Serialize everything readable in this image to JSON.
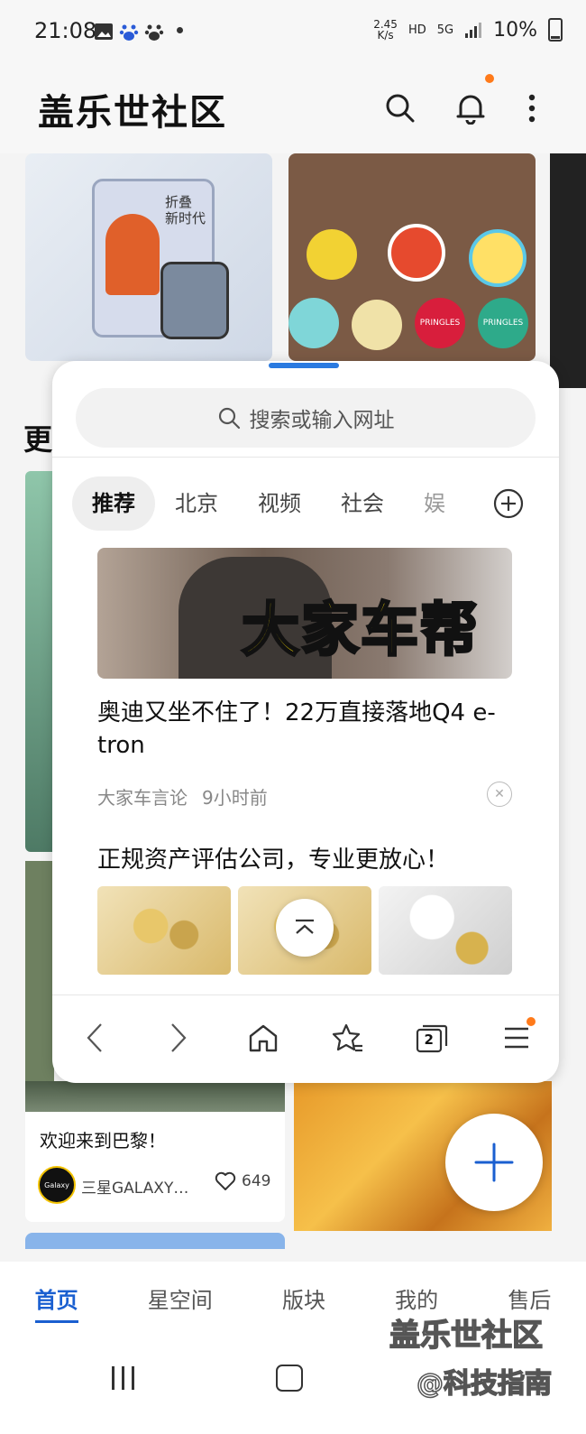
{
  "status_bar": {
    "time": "21:08",
    "speed_value": "2.45",
    "speed_unit": "K/s",
    "hd": "HD",
    "net": "5G",
    "battery": "10%"
  },
  "app": {
    "title": "盖乐世社区"
  },
  "feed": {
    "section_partial": "更",
    "post_caption": "欢迎来到巴黎！",
    "author": "三星GALAXY…",
    "avatar_text": "Galaxy",
    "likes": "649",
    "fold_ad_text": "折叠\n新时代",
    "pringles": "PRINGLES"
  },
  "browser_panel": {
    "search_placeholder": "搜索或输入网址",
    "tabs": [
      "推荐",
      "北京",
      "视频",
      "社会",
      "娱"
    ],
    "news": {
      "banner_text": "大家车帮",
      "title": "奥迪又坐不住了！22万直接落地Q4 e-tron",
      "source": "大家车言论",
      "time": "9小时前"
    },
    "ad": {
      "title": "正规资产评估公司，专业更放心！"
    },
    "tab_count": "2"
  },
  "bottom_nav": {
    "items": [
      "首页",
      "星空间",
      "版块",
      "我的",
      "售后"
    ],
    "active": "首页"
  },
  "watermark": {
    "line1": "盖乐世社区",
    "line2": "@科技指南"
  },
  "colors": {
    "accent": "#1a5fd0",
    "notify": "#ff7a1a"
  }
}
